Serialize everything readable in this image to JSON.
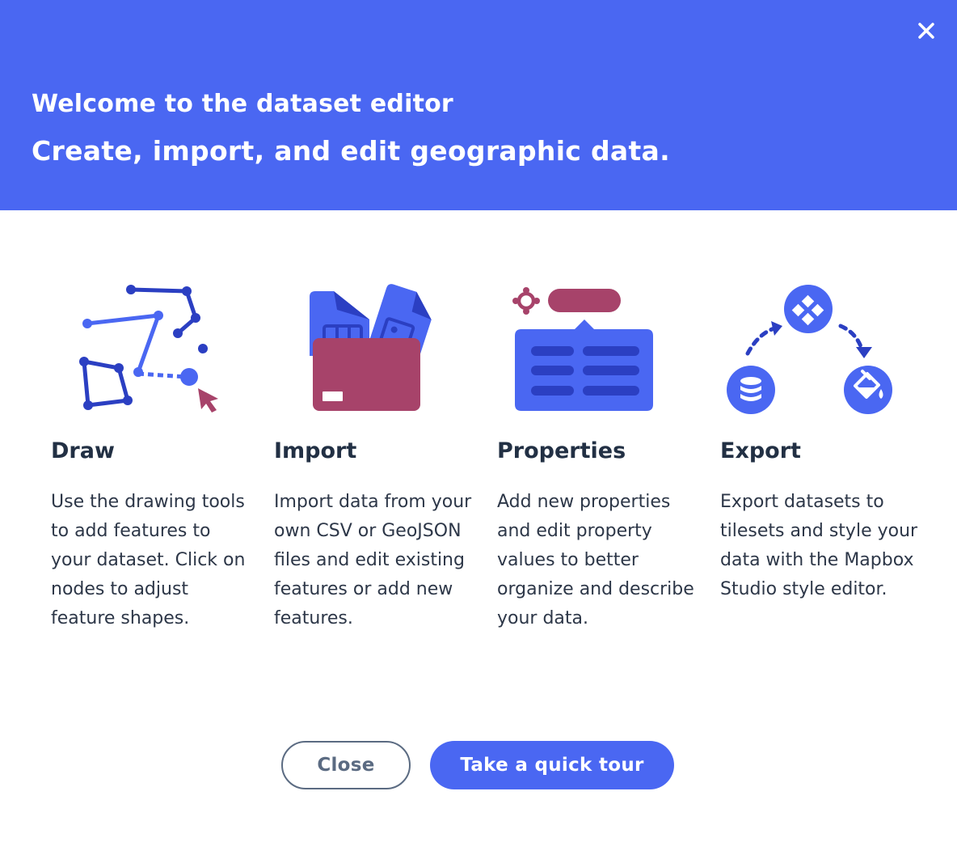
{
  "header": {
    "title": "Welcome to the dataset editor",
    "subtitle": "Create, import, and edit geographic data."
  },
  "features": [
    {
      "title": "Draw",
      "description": "Use the drawing tools to add features to your dataset. Click on nodes to adjust feature shapes."
    },
    {
      "title": "Import",
      "description": "Import data from your own CSV or GeoJSON files and edit existing features or add new features."
    },
    {
      "title": "Properties",
      "description": "Add new properties and edit property values to better organize and describe your data."
    },
    {
      "title": "Export",
      "description": "Export datasets to tilesets and style your data with the Mapbox Studio style editor."
    }
  ],
  "buttons": {
    "close_label": "Close",
    "tour_label": "Take a quick tour"
  },
  "colors": {
    "brand_blue": "#4a67f2",
    "dark_blue": "#2b3fc2",
    "accent_maroon": "#a7436a",
    "heading_text": "#223044",
    "body_text": "#2d3748",
    "outline_gray": "#5b6b82"
  },
  "icons": {
    "close": "close-icon",
    "draw": "draw-illustration",
    "import": "import-illustration",
    "properties": "properties-illustration",
    "export": "export-illustration"
  }
}
